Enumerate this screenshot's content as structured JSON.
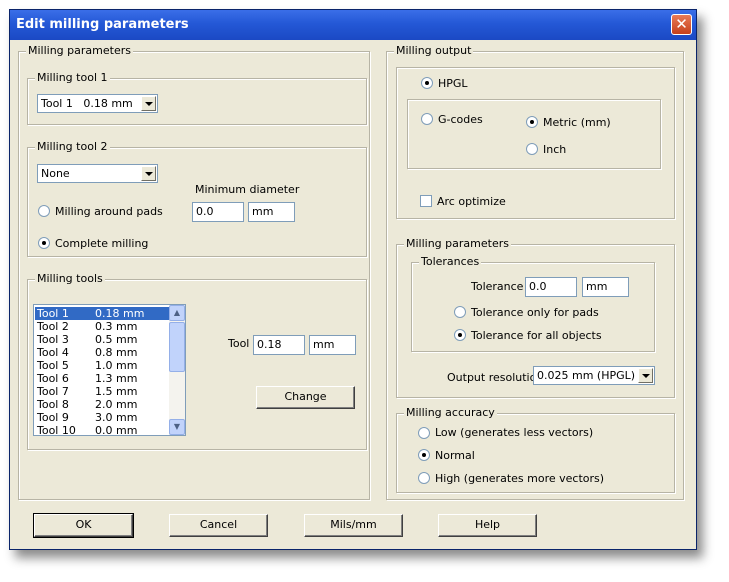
{
  "title": "Edit milling parameters",
  "left": {
    "group_title": "Milling parameters",
    "tool1": {
      "title": "Milling tool 1",
      "selected": "Tool 1   0.18 mm"
    },
    "tool2": {
      "title": "Milling tool 2",
      "selected": "None",
      "min_diameter_label": "Minimum diameter",
      "min_diameter_value": "0.0",
      "min_diameter_unit": "mm",
      "opt_around_pads": "Milling around pads",
      "opt_complete": "Complete milling"
    },
    "tools": {
      "title": "Milling tools",
      "list": [
        {
          "name": "Tool 1",
          "size": "0.18 mm"
        },
        {
          "name": "Tool 2",
          "size": "0.3 mm"
        },
        {
          "name": "Tool 3",
          "size": "0.5 mm"
        },
        {
          "name": "Tool 4",
          "size": "0.8 mm"
        },
        {
          "name": "Tool 5",
          "size": "1.0 mm"
        },
        {
          "name": "Tool 6",
          "size": "1.3 mm"
        },
        {
          "name": "Tool 7",
          "size": "1.5 mm"
        },
        {
          "name": "Tool 8",
          "size": "2.0 mm"
        },
        {
          "name": "Tool 9",
          "size": "3.0 mm"
        },
        {
          "name": "Tool 10",
          "size": "0.0 mm"
        }
      ],
      "selected_index": 0,
      "tool_label": "Tool",
      "tool_value": "0.18",
      "tool_unit": "mm",
      "change_label": "Change"
    }
  },
  "right": {
    "output": {
      "title": "Milling output",
      "hpgl": "HPGL",
      "gcodes": "G-codes",
      "metric": "Metric (mm)",
      "inch": "Inch",
      "arc": "Arc optimize"
    },
    "params": {
      "title": "Milling parameters",
      "tolerances_title": "Tolerances",
      "tolerance_label": "Tolerance",
      "tolerance_value": "0.0",
      "tolerance_unit": "mm",
      "only_pads": "Tolerance only for pads",
      "all_objects": "Tolerance for all objects",
      "resolution_label": "Output resolution",
      "resolution_value": "0.025 mm (HPGL)"
    },
    "accuracy": {
      "title": "Milling accuracy",
      "low": "Low (generates less vectors)",
      "normal": "Normal",
      "high": "High (generates more vectors)"
    }
  },
  "buttons": {
    "ok": "OK",
    "cancel": "Cancel",
    "mils": "Mils/mm",
    "help": "Help"
  }
}
